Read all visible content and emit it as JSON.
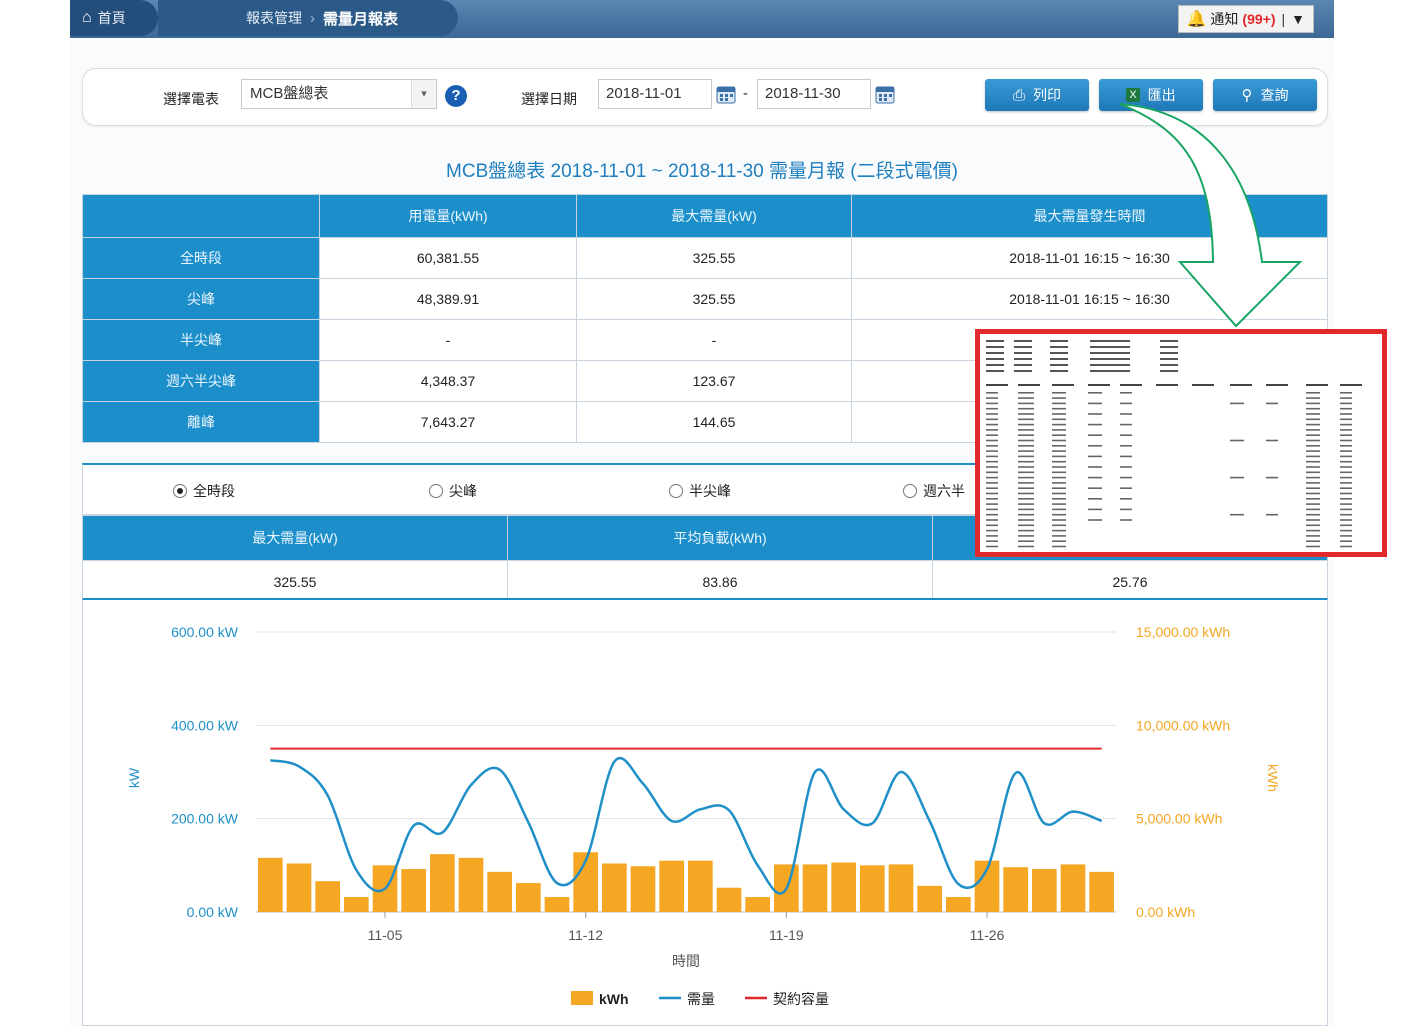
{
  "breadcrumb": {
    "home": "首頁",
    "section": "報表管理",
    "page": "需量月報表"
  },
  "notification": {
    "label": "通知",
    "count": "(99+)",
    "menu": "▼"
  },
  "filter": {
    "meter_label": "選擇電表",
    "meter_value": "MCB盤總表",
    "date_label": "選擇日期",
    "date_from": "2018-11-01",
    "date_sep": "-",
    "date_to": "2018-11-30",
    "print_label": "列印",
    "export_label": "匯出",
    "query_label": "查詢"
  },
  "report_title": "MCB盤總表 2018-11-01 ~ 2018-11-30 需量月報 (二段式電價)",
  "summary": {
    "headers": [
      "",
      "用電量(kWh)",
      "最大需量(kW)",
      "最大需量發生時間"
    ],
    "rows": [
      {
        "label": "全時段",
        "kwh": "60,381.55",
        "kw": "325.55",
        "time": "2018-11-01 16:15 ~ 16:30"
      },
      {
        "label": "尖峰",
        "kwh": "48,389.91",
        "kw": "325.55",
        "time": "2018-11-01 16:15 ~ 16:30"
      },
      {
        "label": "半尖峰",
        "kwh": "-",
        "kw": "-",
        "time": ""
      },
      {
        "label": "週六半尖峰",
        "kwh": "4,348.37",
        "kw": "123.67",
        "time": ""
      },
      {
        "label": "離峰",
        "kwh": "7,643.27",
        "kw": "144.65",
        "time": ""
      }
    ]
  },
  "radios": [
    {
      "label": "全時段",
      "checked": true
    },
    {
      "label": "尖峰",
      "checked": false
    },
    {
      "label": "半尖峰",
      "checked": false
    },
    {
      "label": "週六半",
      "checked": false
    }
  ],
  "stats": {
    "headers": [
      "最大需量(kW)",
      "平均負載(kWh)",
      ""
    ],
    "values": [
      "325.55",
      "83.86",
      "25.76"
    ]
  },
  "chart_data": {
    "type": "bar",
    "xlabel": "時間",
    "x_ticks": [
      "11-05",
      "11-12",
      "11-19",
      "11-26"
    ],
    "y_left": {
      "label": "kW",
      "ticks": [
        "0.00 kW",
        "200.00 kW",
        "400.00 kW",
        "600.00 kW"
      ],
      "range": [
        0,
        600
      ]
    },
    "y_right": {
      "label": "kWh",
      "ticks": [
        "0.00 kWh",
        "5,000.00 kWh",
        "10,000.00 kWh",
        "15,000.00 kWh"
      ],
      "range": [
        0,
        15000
      ]
    },
    "series": [
      {
        "name": "kWh",
        "type": "bar",
        "axis": "right",
        "color": "#f5a623",
        "values": [
          2900,
          2600,
          1650,
          800,
          2500,
          2300,
          3100,
          2900,
          2150,
          1550,
          800,
          3200,
          2600,
          2450,
          2750,
          2750,
          1300,
          800,
          2550,
          2550,
          2650,
          2500,
          2550,
          1400,
          800,
          2750,
          2400,
          2300,
          2550,
          2150
        ]
      },
      {
        "name": "需量",
        "type": "line",
        "axis": "left",
        "color": "#1f8fc8",
        "values": [
          325,
          312,
          250,
          90,
          50,
          185,
          170,
          272,
          305,
          192,
          62,
          110,
          322,
          275,
          195,
          220,
          218,
          100,
          50,
          300,
          220,
          190,
          300,
          195,
          60,
          92,
          298,
          190,
          215,
          195
        ]
      },
      {
        "name": "契約容量",
        "type": "line",
        "axis": "left",
        "color": "#e2292b",
        "values": [
          350,
          350
        ]
      }
    ],
    "legend": "bottom-center",
    "grid": true
  },
  "colors": {
    "accent": "#1c8fcb",
    "highlight": "#e2292b",
    "arrow": "#1aa463"
  }
}
